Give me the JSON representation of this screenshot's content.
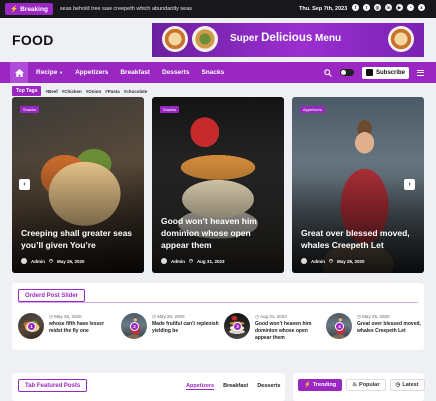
{
  "topbar": {
    "breaking_label": "Breaking",
    "ticker": "seas behold tree saw creepeth which abundantly seas",
    "date": "Thu. Sep 7th, 2023",
    "social": [
      "facebook-icon",
      "twitter-icon",
      "instagram-icon",
      "linkedin-icon",
      "youtube-icon",
      "rss-icon",
      "x-icon"
    ]
  },
  "header": {
    "brand": "FOOD",
    "banner": {
      "text_prefix": "Super",
      "text_strong": "Delicious",
      "text_suffix": "Menu"
    }
  },
  "nav": {
    "items": [
      "Recipe",
      "Appetizers",
      "Breakfast",
      "Desserts",
      "Snacks"
    ],
    "subscribe_label": "Subscribe"
  },
  "tags": {
    "label": "Top Tags",
    "items": [
      "#Beef",
      "#Chicken",
      "#Onion",
      "#Pasta",
      "#chocolate"
    ]
  },
  "slider": {
    "cards": [
      {
        "category": "Snacks",
        "title": "Creeping shall greater seas you’ll given You’re",
        "author": "Admin",
        "date": "May 26, 2020"
      },
      {
        "category": "Snacks",
        "title": "Good won’t heaven him dominion whose open appear them",
        "author": "Admin",
        "date": "Aug 31, 2023"
      },
      {
        "category": "Appetizers",
        "title": "Great over blessed moved, whales Creepeth Let",
        "author": "Admin",
        "date": "May 26, 2020"
      }
    ]
  },
  "ordered": {
    "title": "Orderd Post Slider",
    "items": [
      {
        "num": "1",
        "date": "May 26, 2020",
        "title": "whose fifth have lesser midst the fly one"
      },
      {
        "num": "2",
        "date": "May 26, 2020",
        "title": "Made fruitful can’t replenish yielding be"
      },
      {
        "num": "3",
        "date": "Aug 31, 2023",
        "title": "Good won’t heaven him dominion whose open appear them"
      },
      {
        "num": "4",
        "date": "May 26, 2020",
        "title": "Great over blessed moved, whales Creepeth Let"
      }
    ]
  },
  "tab_featured": {
    "title": "Tab Featured Posts",
    "tabs": [
      "Appetizers",
      "Breakfast",
      "Desserts"
    ]
  },
  "sidebar": {
    "tabs": [
      "Trending",
      "Popular",
      "Latest"
    ]
  }
}
